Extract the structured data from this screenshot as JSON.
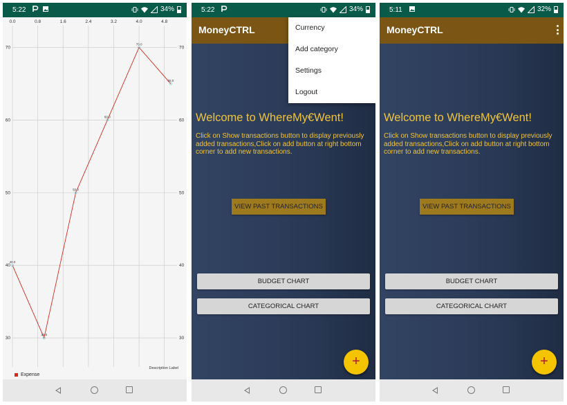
{
  "screens": [
    {
      "status": {
        "time": "5:22",
        "battery": "34%"
      },
      "chart_data": {
        "type": "line",
        "title": "",
        "xlabel": "",
        "ylabel": "",
        "x_ticks": [
          "0.0",
          "0.8",
          "1.6",
          "2.4",
          "3.2",
          "4.0",
          "4.8"
        ],
        "xlim": [
          0,
          5.2
        ],
        "y_ticks": [
          "30",
          "40",
          "50",
          "60",
          "70"
        ],
        "ylim": [
          26,
          73
        ],
        "grid": true,
        "x": [
          0,
          1,
          2,
          3,
          4,
          5
        ],
        "series": [
          {
            "name": "Expense",
            "values": [
              40,
              30,
              50,
              60,
              70,
              65
            ],
            "labels": [
              "40.0",
              "30.0",
              "50.0",
              "60.0",
              "70.0",
              "65.0"
            ],
            "color": "#d62a1e"
          }
        ],
        "description_label": "Description Label",
        "legend_position": "bottom-left"
      }
    },
    {
      "status": {
        "time": "5:22",
        "battery": "34%"
      },
      "app_title": "MoneyCTRL",
      "menu": [
        "Currency",
        "Add category",
        "Settings",
        "Logout"
      ],
      "welcome": "Welcome to WhereMy€Went!",
      "description": "Click on Show transactions button to display previously added transactions,Click on add button at right bottom corner to add new transactions.",
      "view_past": "VIEW PAST TRANSACTIONS",
      "budget_chart": "BUDGET CHART",
      "categorical_chart": "CATEGORICAL CHART",
      "fab": "+"
    },
    {
      "status": {
        "time": "5:11",
        "battery": "32%"
      },
      "app_title": "MoneyCTRL",
      "welcome": "Welcome to WhereMy€Went!",
      "description": "Click on Show transactions button to display previously added transactions,Click on add button at right bottom corner to add new transactions.",
      "view_past": "VIEW PAST TRANSACTIONS",
      "budget_chart": "BUDGET CHART",
      "categorical_chart": "CATEGORICAL CHART",
      "fab": "+"
    }
  ],
  "colors": {
    "status_bar": "#0a5a4a",
    "app_bar": "#7a5514",
    "accent_text": "#f0c43a",
    "primary_button": "#9e7a1e",
    "fab": "#f5c400",
    "fab_icon": "#b0182b"
  },
  "icons": [
    "p-icon",
    "image-icon",
    "vibrate-icon",
    "wifi-icon",
    "signal-icon",
    "battery-icon",
    "overflow-menu-icon",
    "add-icon",
    "nav-back-icon",
    "nav-home-icon",
    "nav-recents-icon"
  ]
}
